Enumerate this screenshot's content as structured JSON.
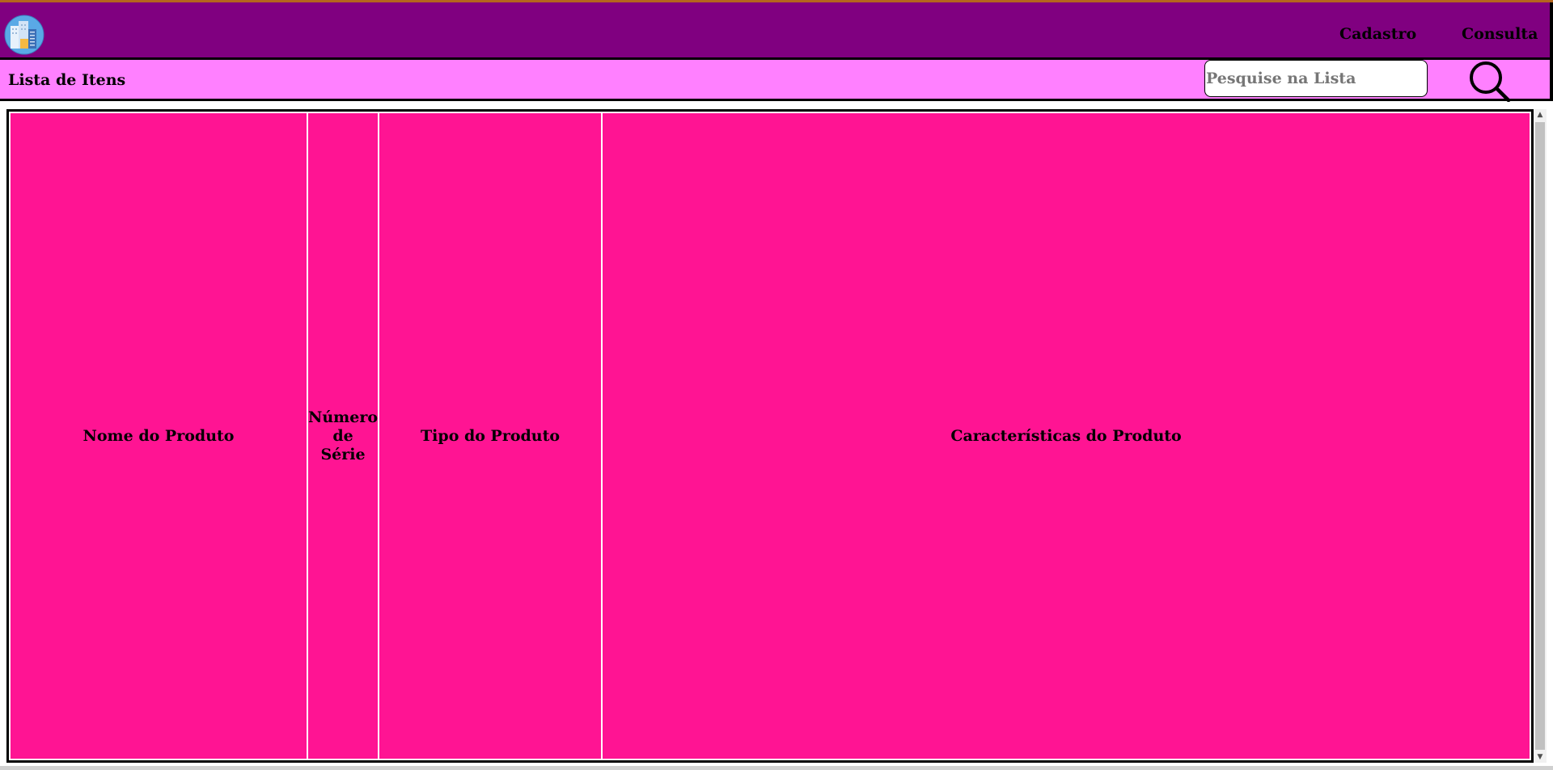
{
  "nav": {
    "links": [
      "Cadastro",
      "Consulta"
    ]
  },
  "subbar": {
    "title": "Lista de Itens",
    "search_placeholder": "Pesquise na Lista"
  },
  "table": {
    "columns": [
      "Nome do Produto",
      "Número de Série",
      "Tipo do Produto",
      "Características do Produto"
    ]
  },
  "colors": {
    "navbar": "#800080",
    "subbar": "#ff80ff",
    "table_header": "#ff1493"
  },
  "icons": {
    "logo": "building-logo-icon",
    "search": "magnifier-icon"
  }
}
